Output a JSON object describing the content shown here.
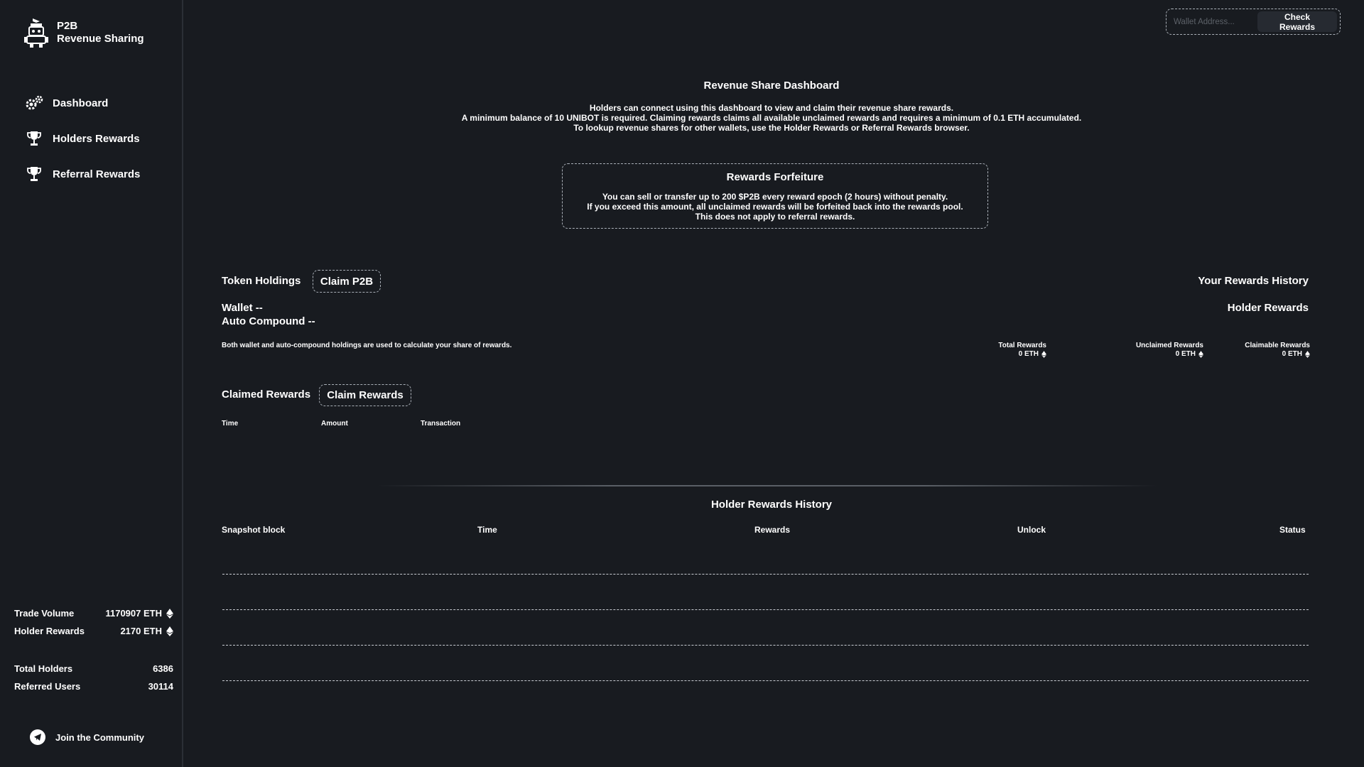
{
  "brand": {
    "line1": "P2B",
    "line2": "Revenue Sharing",
    "logo_icon": "robot-logo-icon"
  },
  "nav": {
    "items": [
      {
        "label": "Dashboard",
        "icon": "gears-icon"
      },
      {
        "label": "Holders Rewards",
        "icon": "trophy-icon"
      },
      {
        "label": "Referral Rewards",
        "icon": "trophy-icon"
      }
    ]
  },
  "stats": {
    "trade_volume_label": "Trade Volume",
    "trade_volume_value": "1170907 ETH",
    "holder_rewards_label": "Holder Rewards",
    "holder_rewards_value": "2170 ETH",
    "total_holders_label": "Total Holders",
    "total_holders_value": "6386",
    "referred_users_label": "Referred Users",
    "referred_users_value": "30114"
  },
  "community": {
    "label": "Join the Community",
    "icon": "telegram-icon"
  },
  "wallet": {
    "placeholder": "Wallet Address...",
    "check_label": "Check Rewards"
  },
  "dashboard": {
    "title": "Revenue Share Dashboard",
    "desc1": "Holders can connect using this dashboard to view and claim their revenue share rewards.",
    "desc2": "A minimum balance of 10 UNIBOT is required. Claiming rewards claims all available unclaimed rewards and requires a minimum of 0.1 ETH accumulated.",
    "desc3": "To lookup revenue shares for other wallets, use the Holder Rewards or Referral Rewards browser."
  },
  "forfeit": {
    "title": "Rewards Forfeiture",
    "line1": "You can sell or transfer up to 200 $P2B every reward epoch (2 hours) without penalty.",
    "line2": "If you exceed this amount, all unclaimed rewards will be forfeited back into the rewards pool.",
    "line3": "This does not apply to referral rewards."
  },
  "holdings": {
    "title": "Token Holdings",
    "claim_label": "Claim P2B",
    "wallet_line": "Wallet --",
    "auto_compound_line": "Auto Compound --",
    "note": "Both wallet and auto-compound holdings are used to calculate your share of rewards."
  },
  "your_history": {
    "title": "Your Rewards History",
    "subtitle": "Holder Rewards",
    "total_label": "Total Rewards",
    "total_value": "0 ETH",
    "unclaimed_label": "Unclaimed Rewards",
    "unclaimed_value": "0 ETH",
    "claimable_label": "Claimable Rewards",
    "claimable_value": "0 ETH"
  },
  "claimed": {
    "title": "Claimed Rewards",
    "claim_label": "Claim Rewards",
    "columns": [
      "Time",
      "Amount",
      "Transaction"
    ]
  },
  "holder_history": {
    "title": "Holder Rewards History",
    "columns": [
      "Snapshot block",
      "Time",
      "Rewards",
      "Unlock",
      "Status"
    ],
    "row_count": 4
  },
  "colors": {
    "background": "#181b20",
    "text": "#ffffff",
    "dashed_border": "#aab0b8"
  }
}
